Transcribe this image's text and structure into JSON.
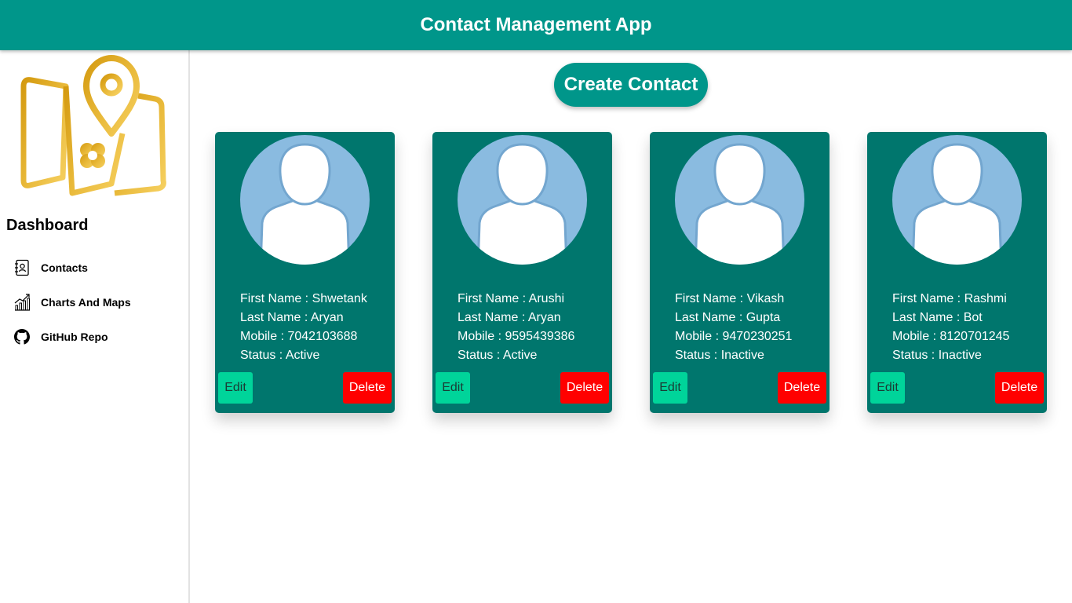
{
  "header": {
    "title": "Contact Management App"
  },
  "sidebar": {
    "logo_icon": "map-location-logo",
    "title": "Dashboard",
    "items": [
      {
        "label": "Contacts",
        "icon": "contacts-book-icon"
      },
      {
        "label": "Charts And Maps",
        "icon": "chart-icon"
      },
      {
        "label": "GitHub Repo",
        "icon": "github-icon"
      }
    ]
  },
  "main": {
    "create_label": "Create Contact",
    "contacts": [
      {
        "first": "First Name : Shwetank",
        "last": "Last Name : Aryan",
        "mobile": "Mobile : 7042103688",
        "status": "Status : Active"
      },
      {
        "first": "First Name : Arushi",
        "last": "Last Name : Aryan",
        "mobile": "Mobile : 9595439386",
        "status": "Status : Active"
      },
      {
        "first": "First Name : Vikash",
        "last": "Last Name : Gupta",
        "mobile": "Mobile : 9470230251",
        "status": "Status : Inactive"
      },
      {
        "first": "First Name : Rashmi",
        "last": "Last Name : Bot",
        "mobile": "Mobile : 8120701245",
        "status": "Status : Inactive"
      }
    ],
    "edit_label": "Edit",
    "delete_label": "Delete"
  },
  "colors": {
    "header": "#00968a",
    "card": "#00766d",
    "edit": "#00d49a",
    "delete": "#ff0000",
    "avatar_bg": "#8abbe0",
    "logo_gold": "#e0a820"
  }
}
